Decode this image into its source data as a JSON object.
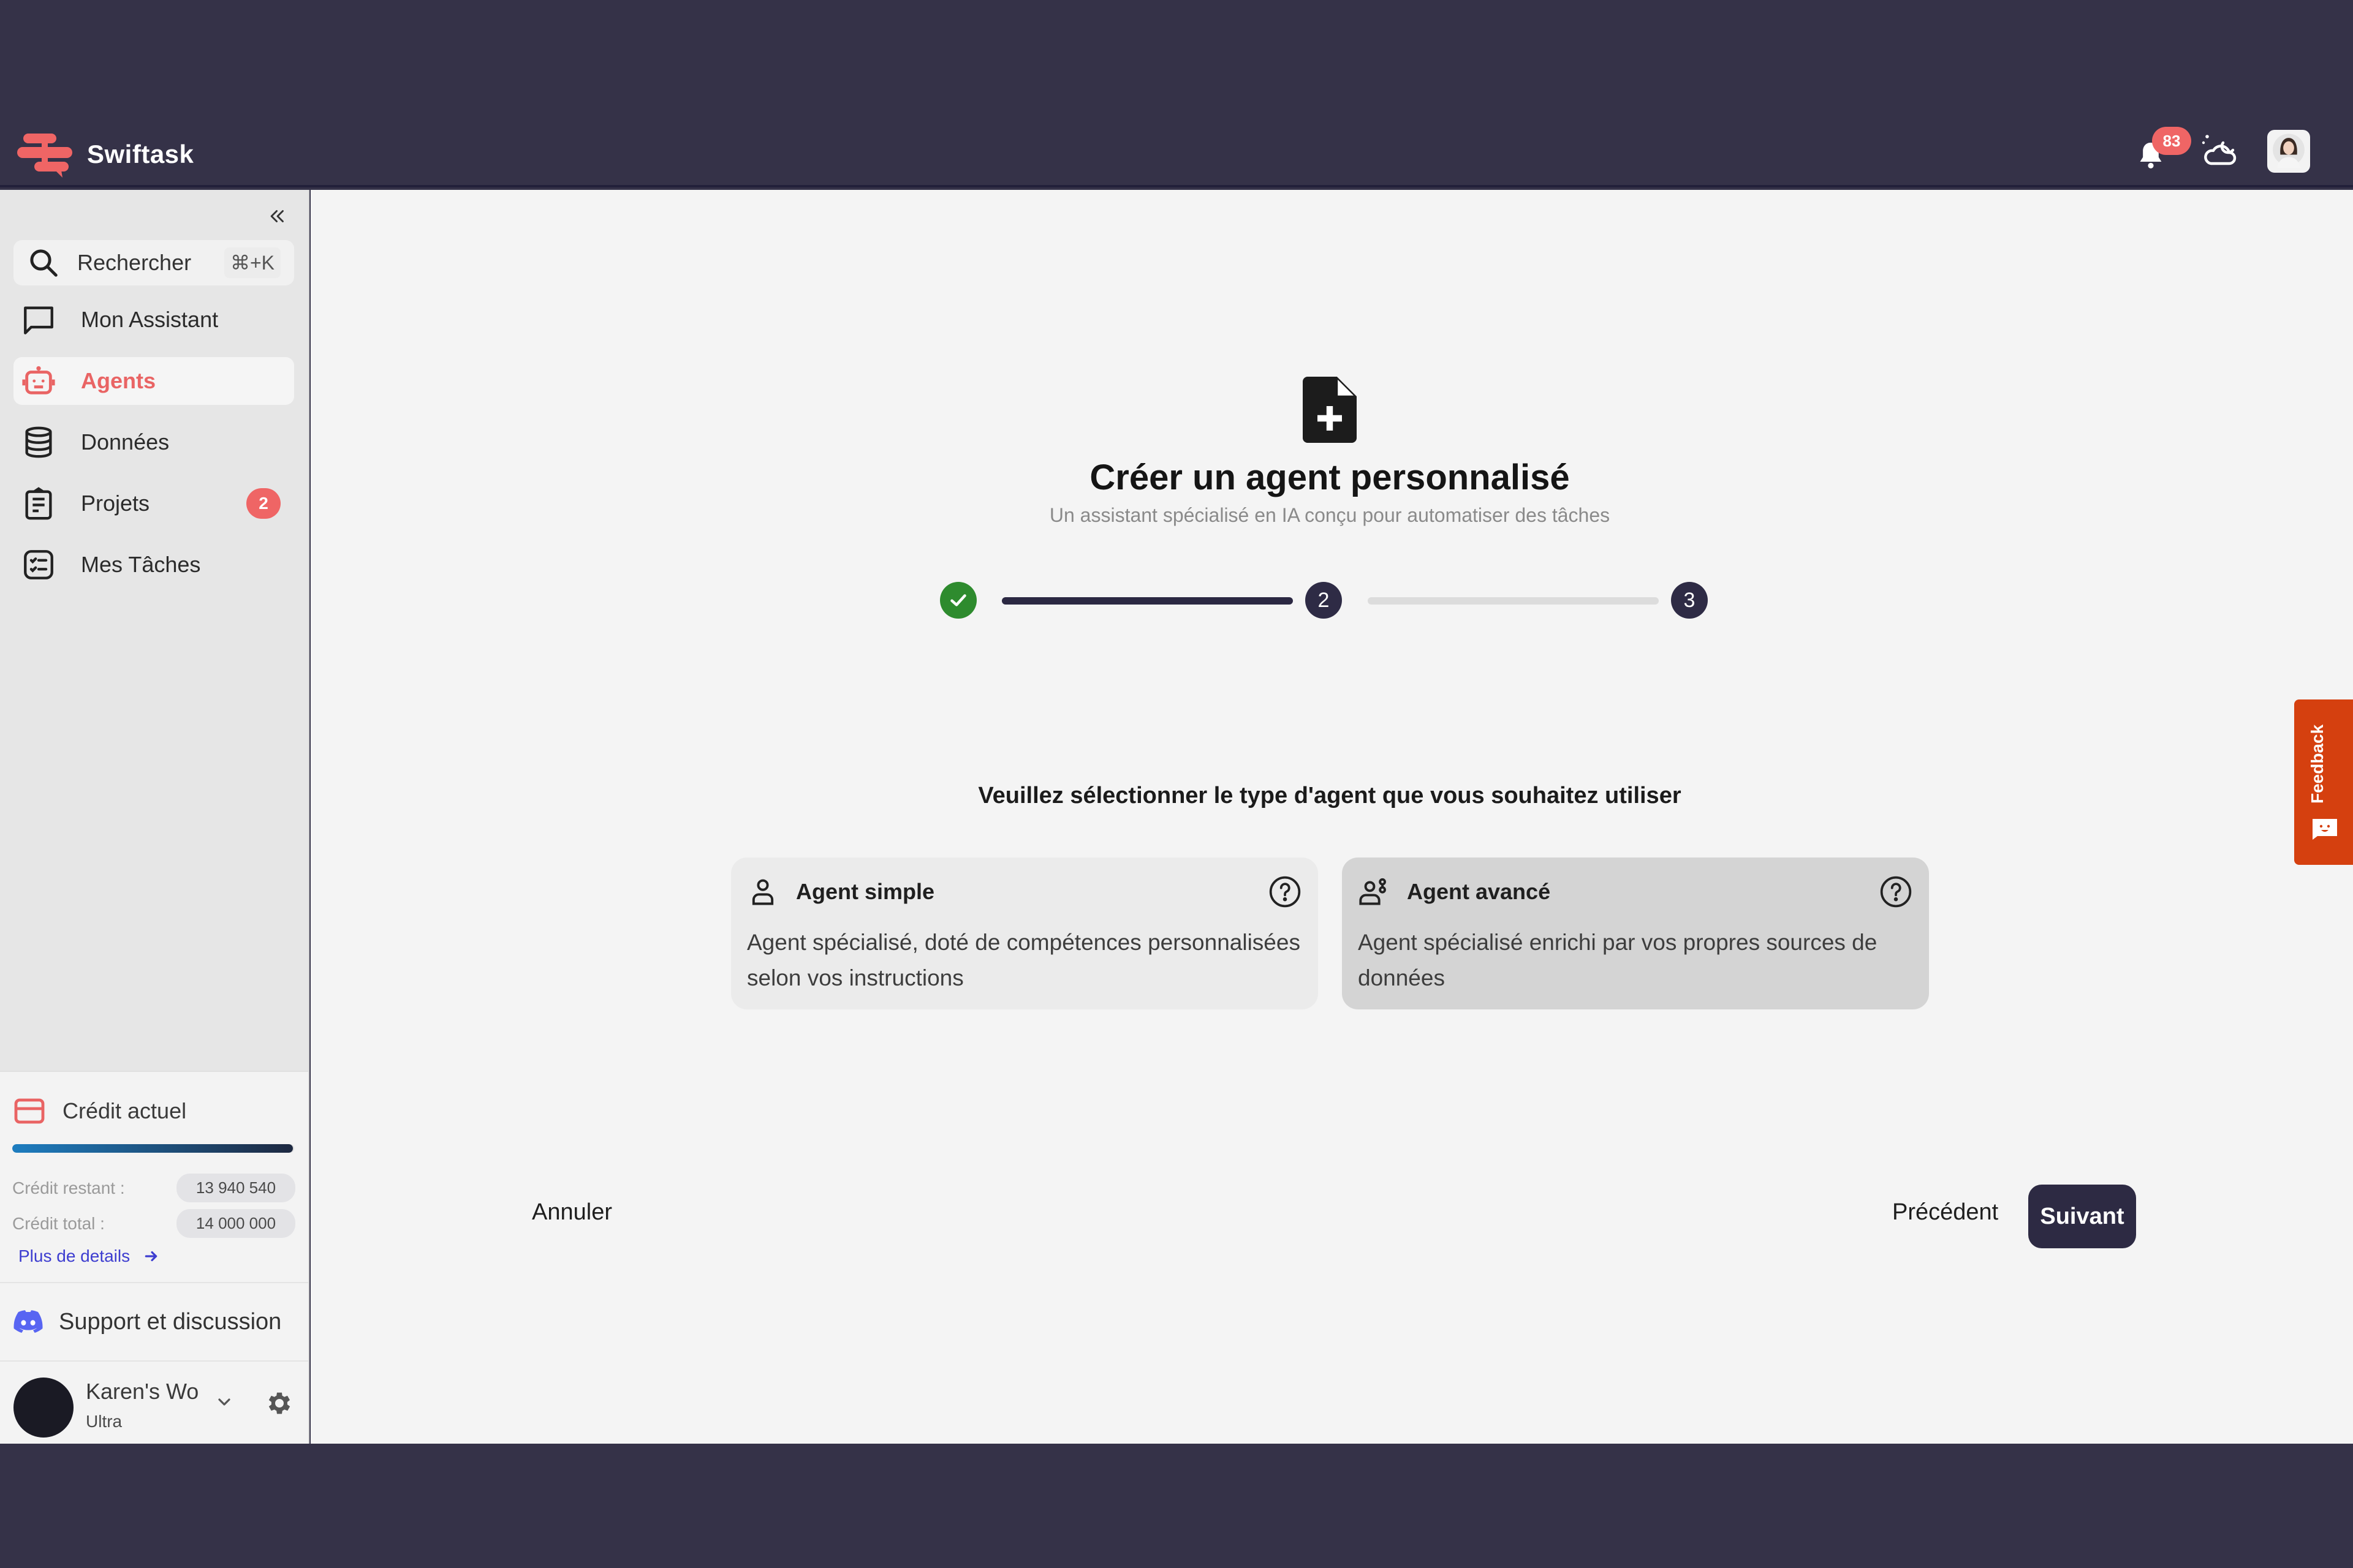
{
  "header": {
    "brand": "Swiftask",
    "notifications_count": "83",
    "brand_color": "#ef6565"
  },
  "sidebar": {
    "collapse_icon": "chevrons-left-icon",
    "search": {
      "label": "Rechercher",
      "shortcut": "⌘+K"
    },
    "items": [
      {
        "label": "Mon Assistant",
        "icon": "chat-icon",
        "active": false
      },
      {
        "label": "Agents",
        "icon": "robot-icon",
        "active": true
      },
      {
        "label": "Données",
        "icon": "database-icon",
        "active": false
      },
      {
        "label": "Projets",
        "icon": "clipboard-icon",
        "active": false,
        "badge": "2"
      },
      {
        "label": "Mes Tâches",
        "icon": "tasks-icon",
        "active": false
      }
    ],
    "credit": {
      "title": "Crédit actuel",
      "remaining_label": "Crédit restant :",
      "remaining_value": "13 940 540",
      "total_label": "Crédit total :",
      "total_value": "14 000 000",
      "remaining_fraction": 0.9957,
      "details_link": "Plus de details"
    },
    "support_label": "Support et discussion",
    "user": {
      "name": "Karen's Wo",
      "plan": "Ultra"
    }
  },
  "main": {
    "title": "Créer un agent personnalisé",
    "subtitle": "Un assistant spécialisé en IA conçu pour automatiser des tâches",
    "stepper": {
      "current_step": 2,
      "steps": [
        {
          "label": "1",
          "status": "done"
        },
        {
          "label": "2",
          "status": "current"
        },
        {
          "label": "3",
          "status": "todo"
        }
      ]
    },
    "question": "Veuillez sélectionner le type d'agent que vous souhaitez utiliser",
    "cards": [
      {
        "title": "Agent simple",
        "description": "Agent spécialisé, doté de compétences personnalisées selon vos instructions",
        "selected": false
      },
      {
        "title": "Agent avancé",
        "description": "Agent spécialisé enrichi par vos propres sources de données",
        "selected": true
      }
    ],
    "buttons": {
      "cancel": "Annuler",
      "previous": "Précédent",
      "next": "Suivant"
    }
  },
  "feedback_tab": {
    "label": "Feedback"
  }
}
